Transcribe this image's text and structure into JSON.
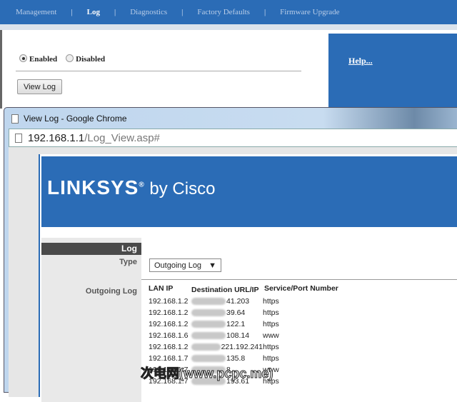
{
  "topnav": {
    "items": [
      "Management",
      "Log",
      "Diagnostics",
      "Factory Defaults",
      "Firmware Upgrade"
    ],
    "separator": "|"
  },
  "settings": {
    "enabled_label": "Enabled",
    "disabled_label": "Disabled",
    "selected": "Enabled",
    "view_log_label": "View Log",
    "help_label": "Help..."
  },
  "popup": {
    "title": "View Log - Google Chrome",
    "url_host": "192.168.1.1",
    "url_path": "/Log_View.asp#",
    "brand": {
      "name": "LINKSYS",
      "reg": "®",
      "suffix": "by Cisco"
    },
    "section": "Log",
    "type_label": "Type",
    "type_value": "Outgoing Log",
    "outgoing_label": "Outgoing Log",
    "columns": [
      "LAN IP",
      "Destination URL/IP",
      "Service/Port Number"
    ],
    "rows": [
      {
        "lan": "192.168.1.2",
        "dest": "41.203",
        "service": "https"
      },
      {
        "lan": "192.168.1.2",
        "dest": "39.64",
        "service": "https"
      },
      {
        "lan": "192.168.1.2",
        "dest": "122.1",
        "service": "https"
      },
      {
        "lan": "192.168.1.6",
        "dest": "108.14",
        "service": "www"
      },
      {
        "lan": "192.168.1.2",
        "dest": "221.192.241",
        "service": "https"
      },
      {
        "lan": "192.168.1.7",
        "dest": "135.8",
        "service": "https"
      },
      {
        "lan": "192.168.1.7",
        "dest": "8.",
        "service": "www"
      },
      {
        "lan": "192.168.1.7",
        "dest": "193.61",
        "service": "https"
      }
    ]
  },
  "watermark": "次电网(www.pcpc.me)"
}
